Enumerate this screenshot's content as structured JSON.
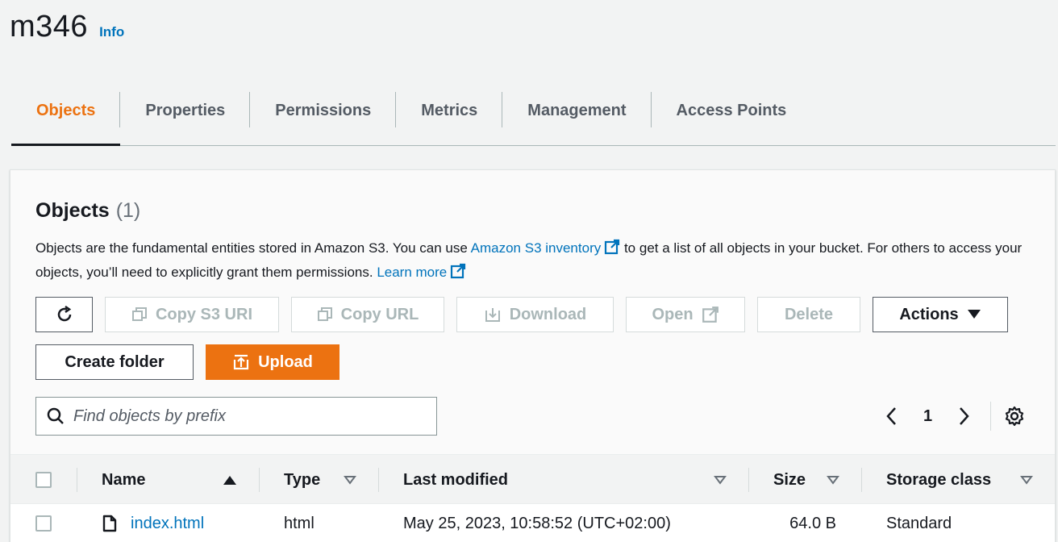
{
  "bucket": {
    "name": "m346",
    "info_label": "Info"
  },
  "tabs": [
    {
      "label": "Objects",
      "active": true
    },
    {
      "label": "Properties"
    },
    {
      "label": "Permissions"
    },
    {
      "label": "Metrics"
    },
    {
      "label": "Management"
    },
    {
      "label": "Access Points"
    }
  ],
  "objects_panel": {
    "title": "Objects",
    "count": "(1)",
    "description": {
      "part1": "Objects are the fundamental entities stored in Amazon S3. You can use ",
      "link1": "Amazon S3 inventory",
      "part2": " to get a list of all objects in your bucket. For others to access your objects, you’ll need to explicitly grant them permissions. ",
      "link2": "Learn more"
    }
  },
  "toolbar": {
    "copy_s3_uri": "Copy S3 URI",
    "copy_url": "Copy URL",
    "download": "Download",
    "open": "Open",
    "delete": "Delete",
    "actions": "Actions",
    "create_folder": "Create folder",
    "upload": "Upload"
  },
  "search": {
    "placeholder": "Find objects by prefix",
    "value": ""
  },
  "pagination": {
    "current_page": "1"
  },
  "table": {
    "columns": [
      "Name",
      "Type",
      "Last modified",
      "Size",
      "Storage class"
    ],
    "rows": [
      {
        "name": "index.html",
        "type": "html",
        "last_modified": "May 25, 2023, 10:58:52 (UTC+02:00)",
        "size": "64.0 B",
        "storage_class": "Standard"
      }
    ]
  },
  "colors": {
    "accent": "#ec7211",
    "link": "#0073bb",
    "text": "#16191f"
  }
}
